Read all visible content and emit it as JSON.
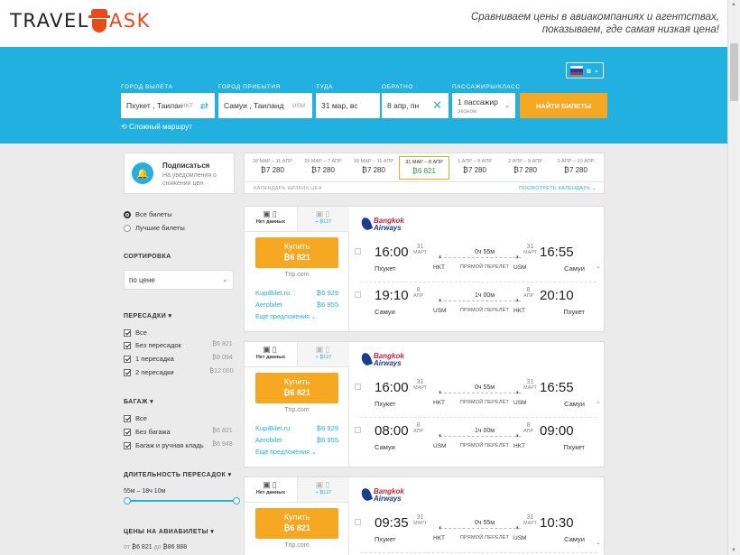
{
  "header": {
    "logo_left": "TRAVEL",
    "logo_right": "ASK",
    "tagline_1": "Сравниваем цены в авиакомпаниях и агентствах,",
    "tagline_2": "показываем, где самая низкая цена!"
  },
  "search": {
    "lang": "в",
    "from_label": "ГОРОД ВЫЛЕТА",
    "from_value": "Пхукет , Таилан",
    "from_code": "HKT",
    "to_label": "ГОРОД ПРИБЫТИЯ",
    "to_value": "Самуи , Таиланд",
    "to_code": "USM",
    "depart_label": "ТУДА",
    "depart_value": "31 мар, вс",
    "return_label": "ОБРАТНО",
    "return_value": "8 апр, пн",
    "pax_label": "ПАССАЖИРЫ/КЛАСС",
    "pax_value": "1 пассажир",
    "pax_class": "эконом",
    "button": "НАЙТИ БИЛЕТЫ",
    "complex_route": "Сложный маршрут"
  },
  "subscribe": {
    "title": "Подписаться",
    "text": "На уведомления о снижении цен"
  },
  "filters": {
    "all_tickets": "Все билеты",
    "best_tickets": "Лучшие билеты",
    "sort_title": "СОРТИРОВКА",
    "sort_value": "по цене",
    "transfers_title": "ПЕРЕСАДКИ",
    "transfers": [
      {
        "label": "Все",
        "price": ""
      },
      {
        "label": "Без пересадок",
        "price": "₿6 821"
      },
      {
        "label": "1 пересадка",
        "price": "₿9 094"
      },
      {
        "label": "2 пересадки",
        "price": "₿12 000"
      }
    ],
    "baggage_title": "БАГАЖ",
    "baggage": [
      {
        "label": "Все",
        "price": ""
      },
      {
        "label": "Без багажа",
        "price": "₿6 821"
      },
      {
        "label": "Багаж и ручная кладь",
        "price": "₿6 948"
      }
    ],
    "duration_title": "ДЛИТЕЛЬНОСТЬ ПЕРЕСАДОК",
    "duration_range": "55м – 18ч 10м",
    "duration_range_fraction": [
      0,
      1
    ],
    "prices_title": "ЦЕНЫ НА АВИАБИЛЕТЫ",
    "prices_from_label": "от",
    "prices_from": "₿6 821",
    "prices_to_label": "до",
    "prices_to": "₿86 888"
  },
  "calendar": {
    "cells": [
      {
        "dates": "28 МАР – 11 АПР",
        "price": "₿7 280"
      },
      {
        "dates": "29 МАР – 7 АПР",
        "price": "₿7 280"
      },
      {
        "dates": "30 МАР – 11 АПР",
        "price": "₿7 280"
      },
      {
        "dates": "31 МАР – 8 АПР",
        "price": "₿6 821"
      },
      {
        "dates": "1 АПР – 9 АПР",
        "price": "₿7 280"
      },
      {
        "dates": "2 АПР – 8 АПР",
        "price": "₿7 280"
      },
      {
        "dates": "3 АПР – 10 АПР",
        "price": "₿7 280"
      }
    ],
    "footer_left": "КАЛЕНДАРЬ НИЗКИХ ЦЕН",
    "footer_right": "ПОСМОТРЕТЬ КАЛЕНДАРЬ ⌄"
  },
  "tickets": [
    {
      "tab1": "Нет данных",
      "tab2": "+ ₿127",
      "buy": "Купить",
      "price": "₿6 821",
      "via": "Trip.com",
      "agents": [
        {
          "name": "KupiBilet.ru",
          "price": "₿6 929"
        },
        {
          "name": "Aerobilet",
          "price": "₿6 955"
        }
      ],
      "more": "Ещё предложения ⌄",
      "airline_1": "Bangkok",
      "airline_2": "Airways",
      "segs": [
        {
          "dep": "16:00",
          "dday": "31",
          "dmon": "МАРТ",
          "from": "Пхукет",
          "c1": "HKT",
          "dur": "0ч 55м",
          "type": "ПРЯМОЙ ПЕРЕЛЁТ",
          "c2": "USM",
          "aday": "31",
          "amon": "МАРТ",
          "arr": "16:55",
          "to": "Самуи"
        },
        {
          "dep": "19:10",
          "dday": "8",
          "dmon": "АПР",
          "from": "Самуи",
          "c1": "USM",
          "dur": "1ч 00м",
          "type": "ПРЯМОЙ ПЕРЕЛЁТ",
          "c2": "HKT",
          "aday": "8",
          "amon": "АПР",
          "arr": "20:10",
          "to": "Пхукет"
        }
      ]
    },
    {
      "tab1": "Нет данных",
      "tab2": "+ ₿127",
      "buy": "Купить",
      "price": "₿6 821",
      "via": "Trip.com",
      "agents": [
        {
          "name": "KupiBilet.ru",
          "price": "₿6 929"
        },
        {
          "name": "Aerobilet",
          "price": "₿6 955"
        }
      ],
      "more": "Ещё предложения ⌄",
      "airline_1": "Bangkok",
      "airline_2": "Airways",
      "segs": [
        {
          "dep": "16:00",
          "dday": "31",
          "dmon": "МАРТ",
          "from": "Пхукет",
          "c1": "HKT",
          "dur": "0ч 55м",
          "type": "ПРЯМОЙ ПЕРЕЛЁТ",
          "c2": "USM",
          "aday": "31",
          "amon": "МАРТ",
          "arr": "16:55",
          "to": "Самуи"
        },
        {
          "dep": "08:00",
          "dday": "8",
          "dmon": "АПР",
          "from": "Самуи",
          "c1": "USM",
          "dur": "1ч 00м",
          "type": "ПРЯМОЙ ПЕРЕЛЁТ",
          "c2": "HKT",
          "aday": "8",
          "amon": "АПР",
          "arr": "09:00",
          "to": "Пхукет"
        }
      ]
    },
    {
      "tab1": "Нет данных",
      "tab2": "+ ₿127",
      "buy": "Купить",
      "price": "₿6 821",
      "via": "Trip.com",
      "airline_1": "Bangkok",
      "airline_2": "Airways",
      "segs": [
        {
          "dep": "09:35",
          "dday": "31",
          "dmon": "МАРТ",
          "from": "Пхукет",
          "c1": "HKT",
          "dur": "0ч 55м",
          "type": "ПРЯМОЙ ПЕРЕЛЁТ",
          "c2": "USM",
          "aday": "31",
          "amon": "МАРТ",
          "arr": "10:30",
          "to": "Самуи"
        }
      ]
    }
  ]
}
